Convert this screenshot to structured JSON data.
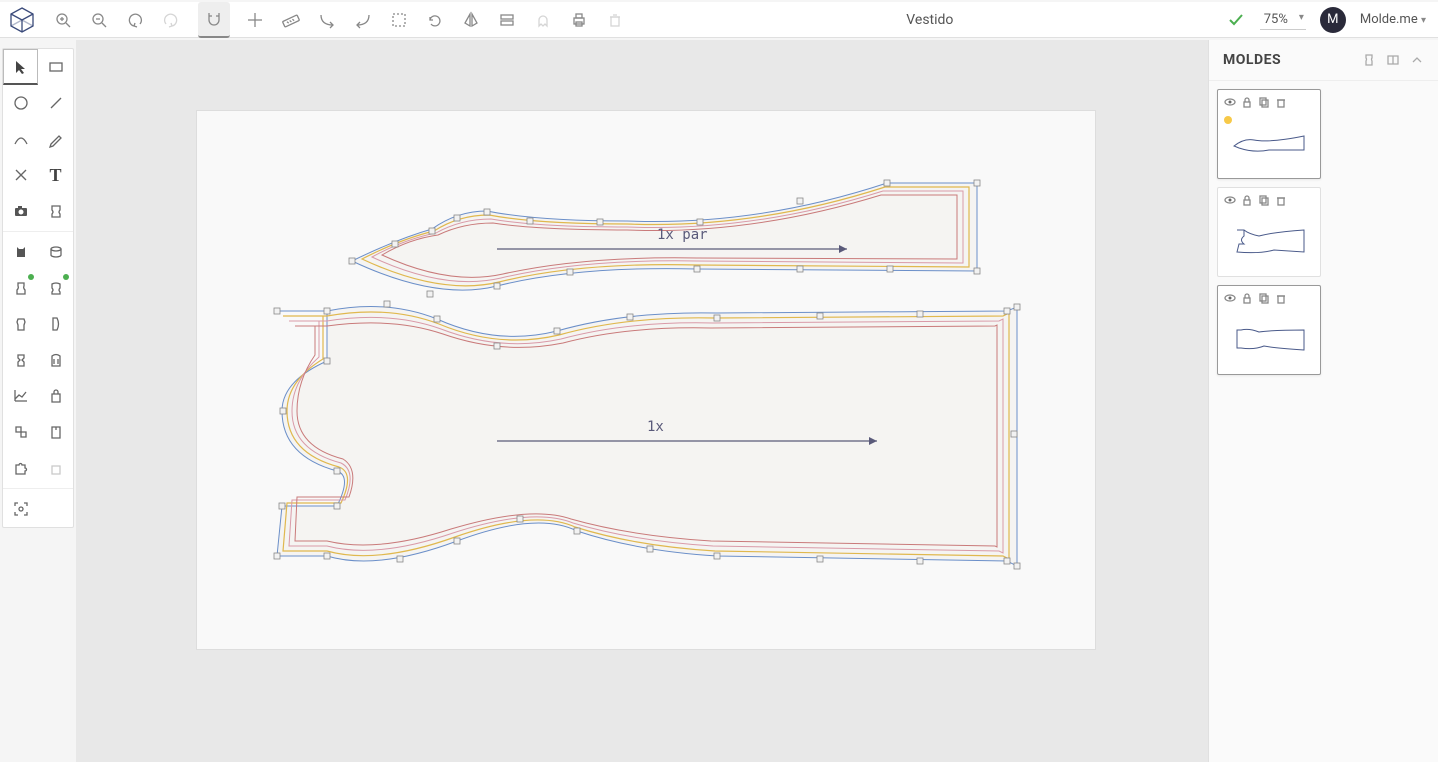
{
  "app": {
    "document_title": "Vestido",
    "zoom": "75%",
    "user_initial": "M",
    "user_label": "Molde.me"
  },
  "panel": {
    "title": "MOLDES"
  },
  "canvas": {
    "sleeve_label": "1x par",
    "body_label": "1x"
  },
  "colors": {
    "outline_blue": "#6b8fc9",
    "grade_yellow": "#e0b84e",
    "grade_pink": "#d99aa8",
    "grade_red": "#c97a7a",
    "node_fill": "#f2f2f2",
    "arrow": "#5a5a7a"
  }
}
